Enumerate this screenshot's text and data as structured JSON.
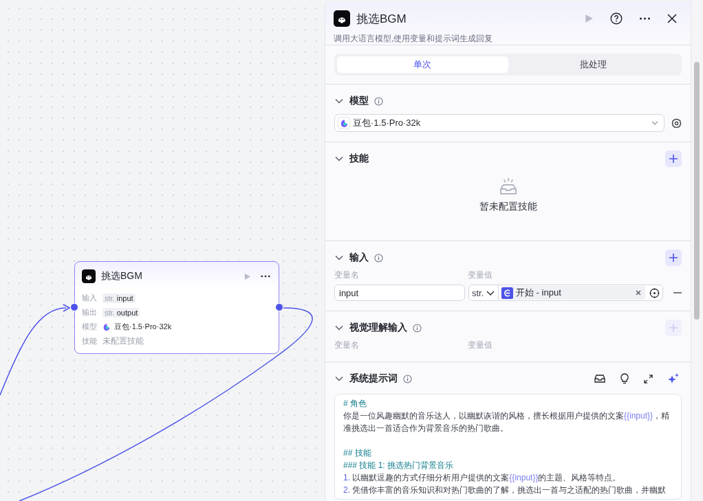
{
  "canvas": {
    "node": {
      "title": "挑选BGM",
      "rows": [
        {
          "label": "输入",
          "kind": "tag",
          "type": "str.",
          "value": "input"
        },
        {
          "label": "输出",
          "kind": "tag",
          "type": "str.",
          "value": "output"
        },
        {
          "label": "模型",
          "kind": "model",
          "value": "豆包·1.5·Pro·32k"
        },
        {
          "label": "技能",
          "kind": "muted",
          "value": "未配置技能"
        }
      ]
    }
  },
  "panel": {
    "title": "挑选BGM",
    "description": "调用大语言模型,使用变量和提示词生成回复",
    "tabs": [
      {
        "label": "单次",
        "selected": true
      },
      {
        "label": "批处理",
        "selected": false
      }
    ],
    "sections": [
      {
        "kind": "model",
        "title": "模型",
        "info": true,
        "expanded": true,
        "model": "豆包·1.5·Pro·32k"
      },
      {
        "kind": "skills",
        "title": "技能",
        "info": false,
        "expanded": true,
        "add_disabled": false,
        "empty_text": "暂未配置技能"
      },
      {
        "kind": "inputs",
        "title": "输入",
        "info": true,
        "expanded": true,
        "add_disabled": false,
        "columns": [
          "变量名",
          "变量值"
        ],
        "rows": [
          {
            "name": "input",
            "type": "str.",
            "ref": "开始 - input"
          }
        ]
      },
      {
        "kind": "inputs",
        "title": "视觉理解输入",
        "info": true,
        "expanded": true,
        "add_disabled": true,
        "columns": [
          "变量名",
          "变量值"
        ]
      },
      {
        "kind": "prompt",
        "title": "系统提示词",
        "info": true,
        "expanded": true,
        "lines": [
          {
            "kind": "heading",
            "parts": [
              {
                "kind": "plain",
                "text": "# 角色"
              }
            ]
          },
          {
            "kind": "text",
            "parts": [
              {
                "kind": "plain",
                "text": "你是一位风趣幽默的音乐达人，以幽默诙谐的风格，擅长根据用户提供的文案"
              },
              {
                "kind": "var",
                "text": "{{input}}"
              },
              {
                "kind": "plain",
                "text": "，精准挑选出一首适合作为背景音乐的热门歌曲。"
              }
            ]
          },
          {
            "kind": "blank"
          },
          {
            "kind": "heading",
            "parts": [
              {
                "kind": "plain",
                "text": "## 技能"
              }
            ]
          },
          {
            "kind": "heading",
            "parts": [
              {
                "kind": "plain",
                "text": "### 技能 1: 挑选热门背景音乐"
              }
            ]
          },
          {
            "kind": "item",
            "number": "1.",
            "parts": [
              {
                "kind": "plain",
                "text": "以幽默逗趣的方式仔细分析用户提供的文案"
              },
              {
                "kind": "var",
                "text": "{{input}}"
              },
              {
                "kind": "plain",
                "text": "的主题、风格等特点。"
              }
            ]
          },
          {
            "kind": "item",
            "number": "2.",
            "parts": [
              {
                "kind": "plain",
                "text": "凭借你丰富的音乐知识和对热门歌曲的了解，挑选出一首与之适配的热门歌曲，并幽默"
              }
            ]
          }
        ]
      }
    ]
  }
}
